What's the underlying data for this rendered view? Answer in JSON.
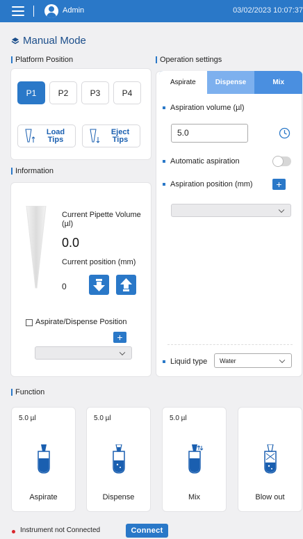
{
  "header": {
    "user": "Admin",
    "datetime": "03/02/2023 10:07:37"
  },
  "mode": {
    "title": "Manual Mode"
  },
  "platform": {
    "title": "Platform Position",
    "positions": [
      "P1",
      "P2",
      "P3",
      "P4"
    ],
    "selected": "P1",
    "load_tips": [
      "Load",
      "Tips"
    ],
    "eject_tips": [
      "Eject",
      "Tips"
    ]
  },
  "information": {
    "title": "Information",
    "volume_label_1": "Current Pipette Volume",
    "volume_label_2": "(µl)",
    "volume_value": "0.0",
    "position_label": "Current position (mm)",
    "position_value": "0",
    "checkbox_label": "Aspirate/Dispense Position",
    "plus": "+"
  },
  "operation": {
    "title": "Operation settings",
    "tabs": [
      "Aspirate",
      "Dispense",
      "Mix"
    ],
    "active_tab": "Aspirate",
    "aspiration_volume_label": "Aspiration volume (µl)",
    "aspiration_volume_value": "5.0",
    "automatic_aspiration_label": "Automatic aspiration",
    "automatic_aspiration_on": false,
    "aspiration_position_label": "Aspiration position (mm)",
    "plus": "+",
    "liquid_type_label": "Liquid type",
    "liquid_type_value": "Water"
  },
  "function": {
    "title": "Function",
    "cards": [
      {
        "volume": "5.0 µl",
        "name": "Aspirate",
        "icon": "aspirate-tube-icon"
      },
      {
        "volume": "5.0 µl",
        "name": "Dispense",
        "icon": "dispense-tube-icon"
      },
      {
        "volume": "5.0 µl",
        "name": "Mix",
        "icon": "mix-tube-icon"
      },
      {
        "volume": "",
        "name": "Blow out",
        "icon": "blowout-tube-icon"
      }
    ]
  },
  "footer": {
    "status": "Instrument not Connected",
    "connect_label": "Connect"
  },
  "colors": {
    "primary": "#2a78c8",
    "tab_light": "#7db0ee",
    "status_red": "#d8262c"
  }
}
